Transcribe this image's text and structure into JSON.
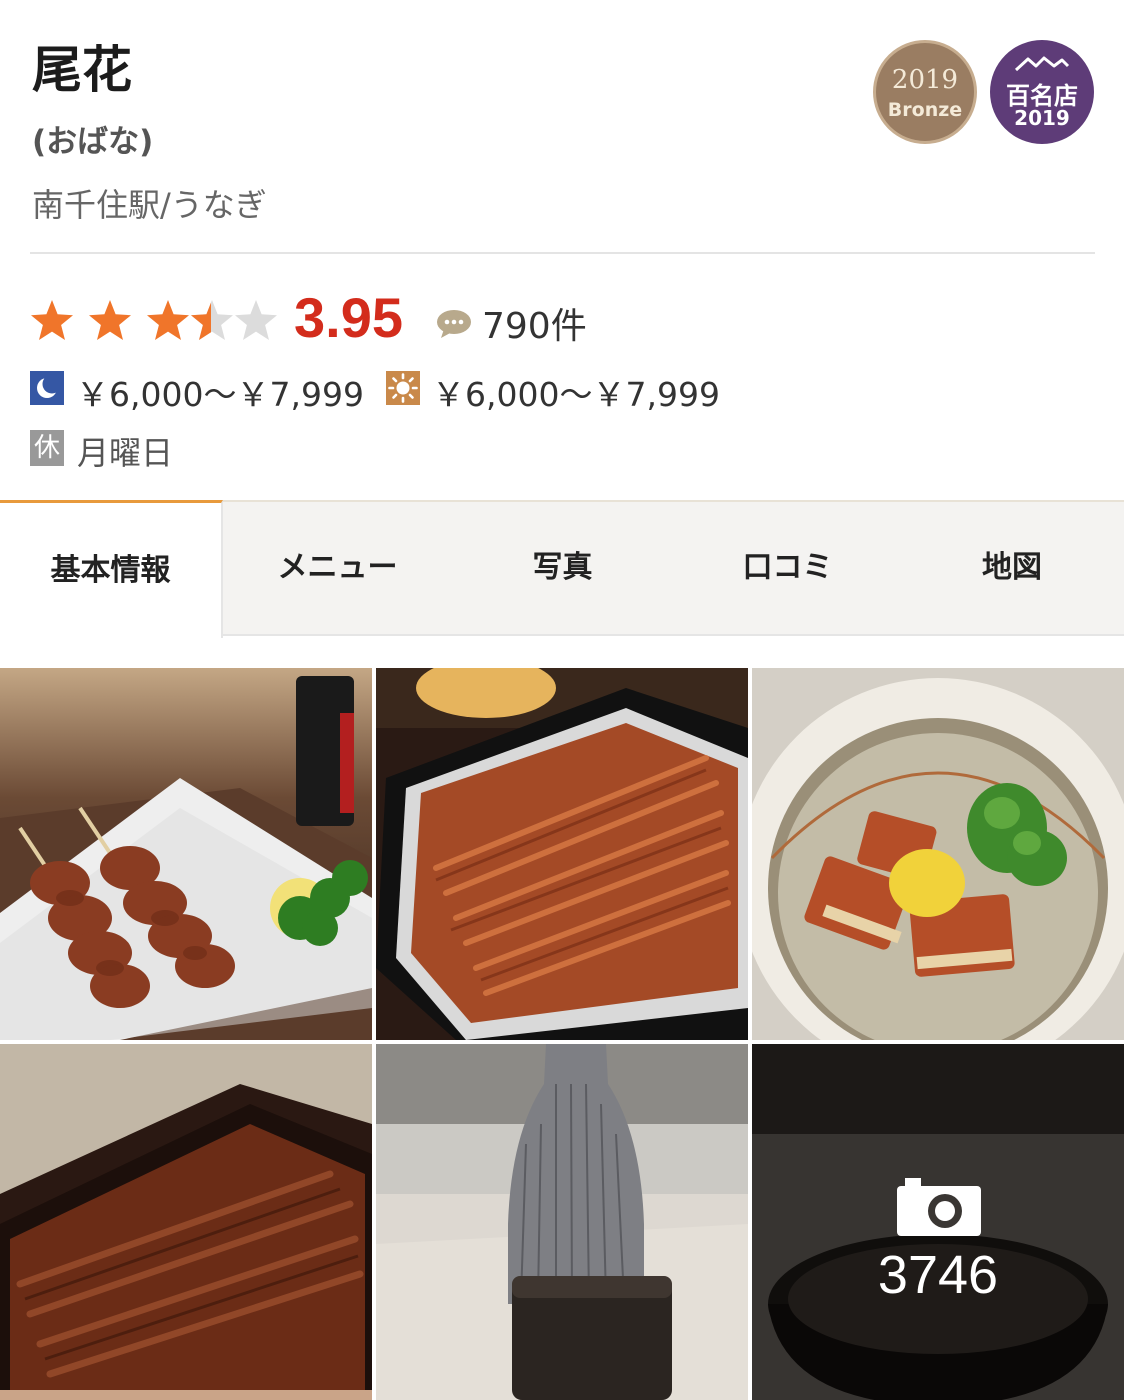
{
  "restaurant": {
    "name": "尾花",
    "reading": "(おばな)",
    "station_genre": "南千住駅/うなぎ"
  },
  "badges": {
    "bronze": {
      "year": "2019",
      "level": "Bronze"
    },
    "hyakumeiten": {
      "label": "百名店",
      "year": "2019"
    }
  },
  "rating": {
    "score": "3.95",
    "stars_value": 3.5,
    "stars_max": 5,
    "review_count": "790件"
  },
  "budget": {
    "dinner": "￥6,000～￥7,999",
    "lunch": "￥6,000～￥7,999",
    "dinner_icon": "moon-icon",
    "lunch_icon": "sun-icon"
  },
  "holiday": {
    "badge": "休",
    "days": "月曜日"
  },
  "tabs": [
    {
      "label": "基本情報",
      "active": true
    },
    {
      "label": "メニュー",
      "active": false
    },
    {
      "label": "写真",
      "active": false
    },
    {
      "label": "口コミ",
      "active": false
    },
    {
      "label": "地図",
      "active": false
    }
  ],
  "photos": {
    "more_count": "3746",
    "items": [
      "yakitori-photo",
      "unaju-photo",
      "umaki-bowl-photo",
      "unaju-box-photo",
      "sake-tokkuri-photo",
      "soup-bowl-photo"
    ]
  },
  "colors": {
    "score": "#d32c1c",
    "star": "#f0752a",
    "star_empty": "#dcdcdc",
    "tab_accent": "#e89a3c",
    "bronze": "#9a7d62",
    "hyakumeiten": "#5e3c78"
  }
}
